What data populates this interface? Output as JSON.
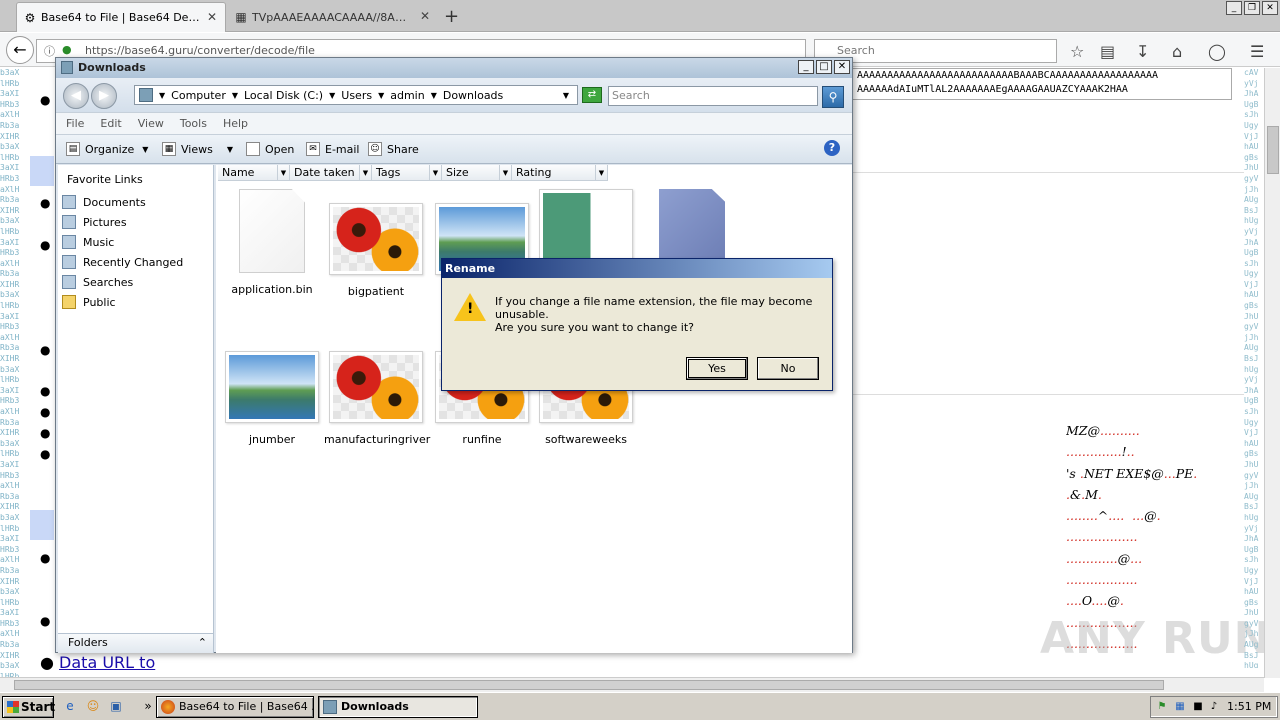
{
  "browser": {
    "tabs": [
      {
        "title": "Base64 to File | Base64 Deco...",
        "active": true
      },
      {
        "title": "TVpAAAEAAAACAAAA//8AAL...",
        "active": false
      }
    ],
    "url": "https://base64.guru/converter/decode/file",
    "search_placeholder": "Search"
  },
  "page": {
    "base64_line1": "AAAAAAAAAAAAAAAAAAAAAAAAAABAAABCAAAAAAAAAAAAAAAAAA",
    "base64_line2": "AAAAAAdAIuMTlAL2AAAAAAAEgAAAAGAAUAZCYAAAK2HAA",
    "link_text": "Data URL to",
    "hex_lines": [
      "MZ@..........",
      "..............!..",
      "'s .NET EXE$@...PE.",
      ".&.M.",
      "........^....  ...@.",
      "..................",
      ".............@...",
      "..................",
      "....O....@.",
      "..................",
      ".................."
    ],
    "watermark": "ANY RUN"
  },
  "explorer": {
    "title": "Downloads",
    "path": [
      "Computer",
      "Local Disk (C:)",
      "Users",
      "admin",
      "Downloads"
    ],
    "search_placeholder": "Search",
    "menu": [
      "File",
      "Edit",
      "View",
      "Tools",
      "Help"
    ],
    "commands": [
      "Organize",
      "Views",
      "Open",
      "E-mail",
      "Share"
    ],
    "favorite_links_title": "Favorite Links",
    "favorites": [
      "Documents",
      "Pictures",
      "Music",
      "Recently Changed",
      "Searches",
      "Public"
    ],
    "folders_label": "Folders",
    "columns": [
      "Name",
      "Date taken",
      "Tags",
      "Size",
      "Rating"
    ],
    "files": [
      {
        "name": "application.bin",
        "type": "blank"
      },
      {
        "name": "bigpatient",
        "type": "flowers"
      },
      {
        "name": "",
        "type": "landscape"
      },
      {
        "name": "",
        "type": "doc"
      },
      {
        "name": "",
        "type": "bluedoc"
      },
      {
        "name": "jnumber",
        "type": "landscape"
      },
      {
        "name": "manufacturingriver",
        "type": "flowers"
      },
      {
        "name": "runfine",
        "type": "flowers"
      },
      {
        "name": "softwareweeks",
        "type": "flowers"
      }
    ]
  },
  "dialog": {
    "title": "Rename",
    "message1": "If you change a file name extension, the file may become unusable.",
    "message2": "Are you sure you want to change it?",
    "yes": "Yes",
    "no": "No"
  },
  "taskbar": {
    "start": "Start",
    "tasks": [
      {
        "label": "Base64 to File | Base64 ...",
        "active": false
      },
      {
        "label": "Downloads",
        "active": true
      }
    ],
    "clock": "1:51 PM"
  }
}
